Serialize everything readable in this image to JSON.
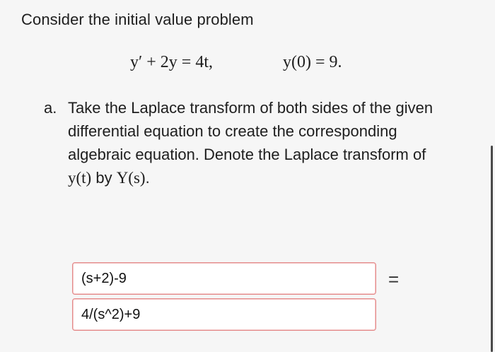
{
  "intro_text": "Consider the initial value problem",
  "equation": {
    "main": "y′ + 2y = 4t,",
    "initial_condition": "y(0) = 9."
  },
  "part_a": {
    "letter": "a.",
    "line1": "Take the Laplace transform of both sides of the given",
    "line2": "differential equation to create the corresponding",
    "line3": "algebraic equation. Denote the Laplace transform of",
    "line4_math1": "y(t)",
    "line4_word": " by ",
    "line4_math2": "Y(s)",
    "line4_end": "."
  },
  "answers": {
    "field1_value": "(s+2)-9",
    "field2_value": "4/(s^2)+9",
    "equals": "="
  },
  "colors": {
    "field_border": "#e48a8a",
    "background": "#f6f6f6"
  }
}
